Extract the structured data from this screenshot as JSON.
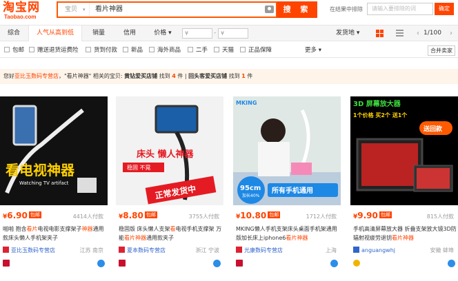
{
  "header": {
    "logo": "淘宝网",
    "logo_sub": "Taobao.com",
    "search": {
      "category": "宝贝",
      "value": "看片神器",
      "button": "搜 索"
    },
    "exclude": {
      "label": "在结果中排除",
      "placeholder": "请输入要排除的词",
      "button": "确定"
    }
  },
  "sortbar": {
    "tabs": [
      "综合",
      "人气从高到低",
      "销量",
      "信用",
      "价格"
    ],
    "active_tab": "人气从高到低",
    "price_from": "¥",
    "price_to": "¥",
    "dash": "-",
    "ship_from": "发货地",
    "pager": "1/100",
    "prev": "‹",
    "next": "›"
  },
  "filters": {
    "items": [
      "包邮",
      "赠送退货运费险",
      "货到付款",
      "新品",
      "海外商品",
      "二手",
      "天猫",
      "正品保障"
    ],
    "more": "更多",
    "merge": "合并卖家"
  },
  "notice": {
    "t1": "您好",
    "shop1": "亚比玉数码专营店",
    "t2": "，\"看片神器\" 相关的宝贝:",
    "s1": "黄钻爱买店铺",
    "t3": "找到",
    "n1": "4",
    "t4": "件",
    "sep": "|",
    "s2": "回头客爱买店铺",
    "t5": "找到",
    "n2": "1",
    "t6": "件"
  },
  "products": [
    {
      "price_symbol": "¥",
      "price": "6.90",
      "post_label": "包邮",
      "paid": "4414人付款",
      "title_a": "啪啪 抱含",
      "title_hl": "看片",
      "title_b": "电视电影支撑架子",
      "title_hl2": "神器",
      "title_c": "通用款床头懒人手机架夹子",
      "shop": "亚比玉数码专营店",
      "location": "江苏 南京",
      "banner": "看电视神器",
      "banner_sub": "Watching TV artifact"
    },
    {
      "price_symbol": "¥",
      "price": "8.80",
      "post_label": "包邮",
      "paid": "3755人付款",
      "title_a": "稳固版 床头懒人支架",
      "title_hl": "看",
      "title_b": "电视手机支撑架 万能",
      "title_hl2": "看片神器",
      "title_c": "通用款夹子",
      "shop": "夏本数码专营店",
      "location": "浙江 宁波",
      "banner": "床头 懒人神器",
      "banner_sub": "稳固 不晃",
      "banner2": "正常发货中"
    },
    {
      "price_symbol": "¥",
      "price": "10.80",
      "post_label": "包邮",
      "paid": "1712人付款",
      "title_a": "MKING懒人手机支架床头桌面手机架通用版加长床上iphone6",
      "title_hl": "看片神器",
      "title_b": "",
      "title_hl2": "",
      "title_c": "",
      "shop": "光康数码专营店",
      "location": "上海",
      "banner": "MKING",
      "banner_len": "95cm",
      "banner_len_sub": "加长40%",
      "banner2": "所有手机通用"
    },
    {
      "price_symbol": "¥",
      "price": "9.90",
      "post_label": "包邮",
      "paid": "815人付款",
      "title_a": "手机高清屏幕放大器 折叠支架放大镜3D防辐射视疲劳退钥",
      "title_hl": "看片神器",
      "title_b": "",
      "title_hl2": "",
      "title_c": "",
      "shop": "anguangwhj",
      "location": "安徽 蚌埠",
      "banner": "3D 屏幕放大器",
      "banner_sub": "1个价格 买2个 送1个",
      "banner2": "送回款"
    }
  ]
}
